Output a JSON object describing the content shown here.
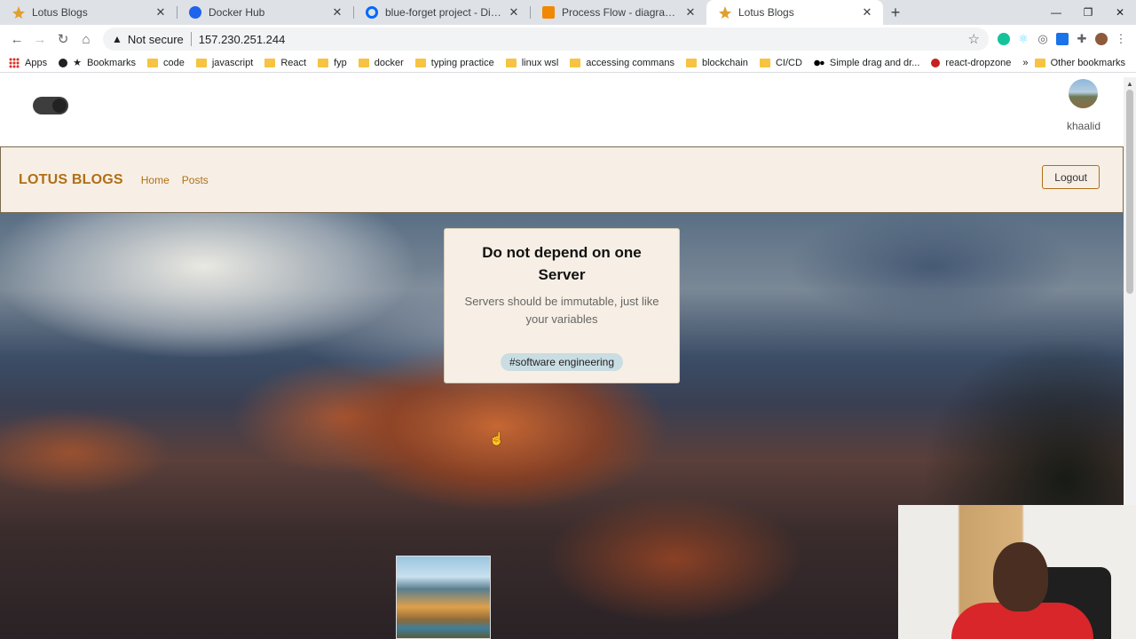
{
  "browser": {
    "tabs": [
      {
        "title": "Lotus Blogs",
        "favicon": "lotus-favicon",
        "active": false
      },
      {
        "title": "Docker Hub",
        "favicon": "docker-favicon",
        "active": false
      },
      {
        "title": "blue-forget project - DigitalOce",
        "favicon": "digitalocean-favicon",
        "active": false
      },
      {
        "title": "Process Flow - diagrams.net",
        "favicon": "diagrams-favicon",
        "active": false
      },
      {
        "title": "Lotus Blogs",
        "favicon": "lotus-favicon",
        "active": true
      }
    ],
    "new_tab": "+",
    "window_controls": {
      "minimize": "—",
      "maximize": "❐",
      "close": "✕"
    },
    "nav": {
      "back": "←",
      "forward": "→",
      "reload": "↻",
      "home": "⌂"
    },
    "security_warning": "Not secure",
    "url": "157.230.251.244",
    "bookmarks": [
      {
        "label": "Apps",
        "icon": "apps-grid-icon"
      },
      {
        "label": "Bookmarks",
        "icon": "star-icon"
      },
      {
        "label": "code",
        "icon": "folder-icon"
      },
      {
        "label": "javascript",
        "icon": "folder-icon"
      },
      {
        "label": "React",
        "icon": "folder-icon"
      },
      {
        "label": "fyp",
        "icon": "folder-icon"
      },
      {
        "label": "docker",
        "icon": "folder-icon"
      },
      {
        "label": "typing practice",
        "icon": "folder-icon"
      },
      {
        "label": "linux wsl",
        "icon": "folder-icon"
      },
      {
        "label": "accessing commans",
        "icon": "folder-icon"
      },
      {
        "label": "blockchain",
        "icon": "folder-icon"
      },
      {
        "label": "CI/CD",
        "icon": "folder-icon"
      },
      {
        "label": "Simple drag and dr...",
        "icon": "medium-icon"
      },
      {
        "label": "react-dropzone",
        "icon": "red-site-icon"
      }
    ],
    "bookmarks_overflow": "»",
    "other_bookmarks": "Other bookmarks"
  },
  "page": {
    "user": {
      "name": "khaalid"
    },
    "navbar": {
      "brand": "LOTUS BLOGS",
      "links": [
        "Home",
        "Posts"
      ],
      "logout_label": "Logout"
    },
    "post_card": {
      "title": "Do not depend on one Server",
      "description": "Servers should be immutable, just like your variables",
      "tag": "#software engineering"
    }
  },
  "colors": {
    "brand": "#b06f15",
    "navbar_bg": "#f7efe5",
    "tag_bg": "#c9dde3",
    "toggle": "#3d3d3d"
  }
}
